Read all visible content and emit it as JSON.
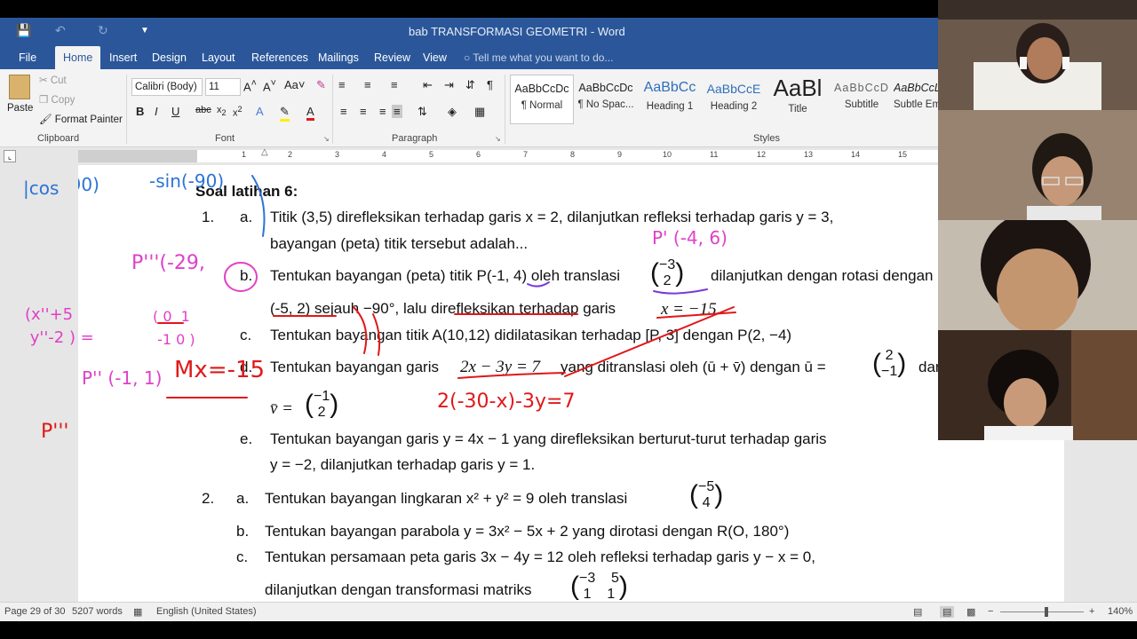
{
  "window": {
    "title": "bab TRANSFORMASI GEOMETRI - Word"
  },
  "menu": {
    "tabs": [
      "File",
      "Home",
      "Insert",
      "Design",
      "Layout",
      "References",
      "Mailings",
      "Review",
      "View"
    ],
    "tell_me": "Tell me what you want to do..."
  },
  "ribbon": {
    "clipboard": {
      "paste": "Paste",
      "cut": "Cut",
      "copy": "Copy",
      "format_painter": "Format Painter",
      "label": "Clipboard"
    },
    "font": {
      "family": "Calibri (Body)",
      "size": "11",
      "label": "Font"
    },
    "paragraph": {
      "label": "Paragraph"
    },
    "styles": {
      "label": "Styles",
      "items": [
        {
          "preview": "AaBbCcDc",
          "name": "¶ Normal"
        },
        {
          "preview": "AaBbCcDc",
          "name": "¶ No Spac..."
        },
        {
          "preview": "AaBbCc",
          "name": "Heading 1"
        },
        {
          "preview": "AaBbCcE",
          "name": "Heading 2"
        },
        {
          "preview": "AaBl",
          "name": "Title"
        },
        {
          "preview": "AaBbCcD",
          "name": "Subtitle"
        },
        {
          "preview": "AaBbCcL",
          "name": "Subtle Em"
        }
      ]
    }
  },
  "ruler": {
    "numbers": [
      "1",
      "2",
      "3",
      "4",
      "5",
      "6",
      "7",
      "8",
      "9",
      "10",
      "11",
      "12",
      "13",
      "14",
      "15"
    ]
  },
  "document": {
    "heading": "Soal latihan 6:",
    "q1": {
      "num": "1.",
      "a_label": "a.",
      "a_line1": "Titik (3,5) direfleksikan terhadap garis x = 2, dilanjutkan refleksi  terhadap garis y = 3,",
      "a_line2": "bayangan (peta) titik  tersebut adalah...",
      "b_label": "b.",
      "b_text1": "Tentukan bayangan (peta) titik P(-1, 4) oleh translasi",
      "b_vec_top": "−3",
      "b_vec_bot": "2",
      "b_text2": "dilanjutkan dengan rotasi dengan pusat",
      "b_line2": "(-5, 2) sejauh −90°, lalu direfleksikan terhadap garis",
      "b_eq": "x = −15.",
      "c_label": "c.",
      "c_text": "Tentukan bayangan titik A(10,12) didilatasikan terhadap [P,  3] dengan P(2, −4)",
      "d_label": "d.",
      "d_text1": "Tentukan bayangan garis",
      "d_eq": "2x − 3y = 7",
      "d_text2": "yang ditranslasi oleh (ū + v̄) dengan ū =",
      "d_vec_top": "2",
      "d_vec_bot": "−1",
      "d_text3": "dan",
      "d_line2": "v̄ =",
      "d_vec2_top": "−1",
      "d_vec2_bot": "2",
      "e_label": "e.",
      "e_line1": "Tentukan  bayangan  garis  y = 4x − 1  yang  direfleksikan  berturut-turut  terhadap  garis",
      "e_line2": "y = −2, dilanjutkan terhadap garis y = 1."
    },
    "q2": {
      "num": "2.",
      "a_label": "a.",
      "a_text": "Tentukan bayangan lingkaran x² + y² = 9 oleh translasi",
      "a_vec_top": "−5",
      "a_vec_bot": "4",
      "b_label": "b.",
      "b_text": "Tentukan bayangan parabola y = 3x² − 5x + 2 yang dirotasi dengan R(O, 180°)",
      "c_label": "c.",
      "c_line1": "Tentukan  persamaan  peta  garis  3x − 4y = 12  oleh  refleksi  terhadap  garis  y − x = 0,",
      "c_line2": "dilanjutkan dengan transformasi matriks",
      "c_m_top": "−3    5",
      "c_m_bot": "1    1"
    }
  },
  "annotations": {
    "blue_cos": "cos(-90)",
    "blue_sin": "-sin(-90)",
    "pink_p3": "P'''(-29,",
    "pink_matrix_left": "x''+5 / y''-2",
    "pink_matrix_mid": "0  1 / -1  0",
    "pink_p1": "P' (-4, 6)",
    "red_p2": "P'' (-1, 1)",
    "red_mx": "Mx=-15",
    "red_p3": "P'''",
    "red_eq": "2(-30-x)-3y=7"
  },
  "statusbar": {
    "page": "Page 29 of 30",
    "words": "5207 words",
    "language": "English (United States)",
    "zoom": "140%"
  },
  "colors": {
    "title_bar": "#2b579a",
    "ink_blue": "#2b73d6",
    "ink_pink": "#e040c8",
    "ink_red": "#e01818"
  }
}
